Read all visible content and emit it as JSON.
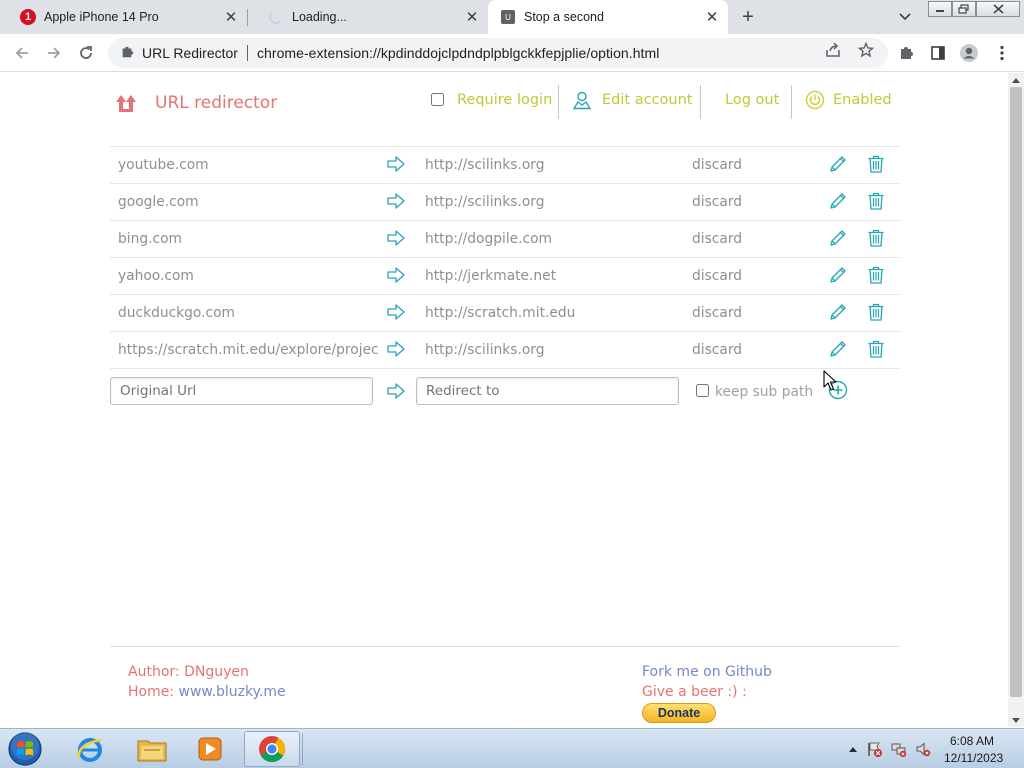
{
  "browser": {
    "tabs": [
      {
        "title": "Apple iPhone 14 Pro",
        "icon": "opera-red-icon",
        "active": false
      },
      {
        "title": "Loading...",
        "icon": "loading-spinner-icon",
        "active": false
      },
      {
        "title": "Stop a second",
        "icon": "u-extension-icon",
        "favicon_letter": "U",
        "active": true
      }
    ],
    "omnibox": {
      "extension_name": "URL Redirector",
      "url": "chrome-extension://kpdinddojclpdndplpblgckkfepjplie/option.html"
    }
  },
  "app": {
    "title": "URL redirector",
    "header": {
      "require_login": "Require login",
      "require_login_checked": false,
      "edit_account": "Edit account",
      "log_out": "Log out",
      "enabled": "Enabled"
    },
    "rules": [
      {
        "original": "youtube.com",
        "redirect": "http://scilinks.org",
        "mode": "discard"
      },
      {
        "original": "google.com",
        "redirect": "http://scilinks.org",
        "mode": "discard"
      },
      {
        "original": "bing.com",
        "redirect": "http://dogpile.com",
        "mode": "discard"
      },
      {
        "original": "yahoo.com",
        "redirect": "http://jerkmate.net",
        "mode": "discard"
      },
      {
        "original": "duckduckgo.com",
        "redirect": "http://scratch.mit.edu",
        "mode": "discard"
      },
      {
        "original": "https://scratch.mit.edu/explore/projects/a",
        "redirect": "http://scilinks.org",
        "mode": "discard"
      }
    ],
    "new_rule": {
      "original_placeholder": "Original Url",
      "redirect_placeholder": "Redirect to",
      "keep_sub_path": "keep sub path",
      "keep_sub_path_checked": false
    },
    "footer": {
      "author_label": "Author: ",
      "author_name": "DNguyen",
      "home_label": "Home: ",
      "home_url": "www.bluzky.me",
      "fork_link": "Fork me on Github",
      "beer_text": "Give a beer :) :",
      "donate_button": "Donate"
    },
    "colors": {
      "title": "#e57373",
      "header_link": "#c0ca33",
      "icon_teal": "#26a6b5",
      "text_gray": "#8f8f8f",
      "link_blue": "#7986cb"
    }
  },
  "taskbar": {
    "time": "6:08 AM",
    "date": "12/11/2023",
    "apps": [
      "internet-explorer-icon",
      "file-explorer-icon",
      "media-player-icon",
      "chrome-icon"
    ]
  }
}
